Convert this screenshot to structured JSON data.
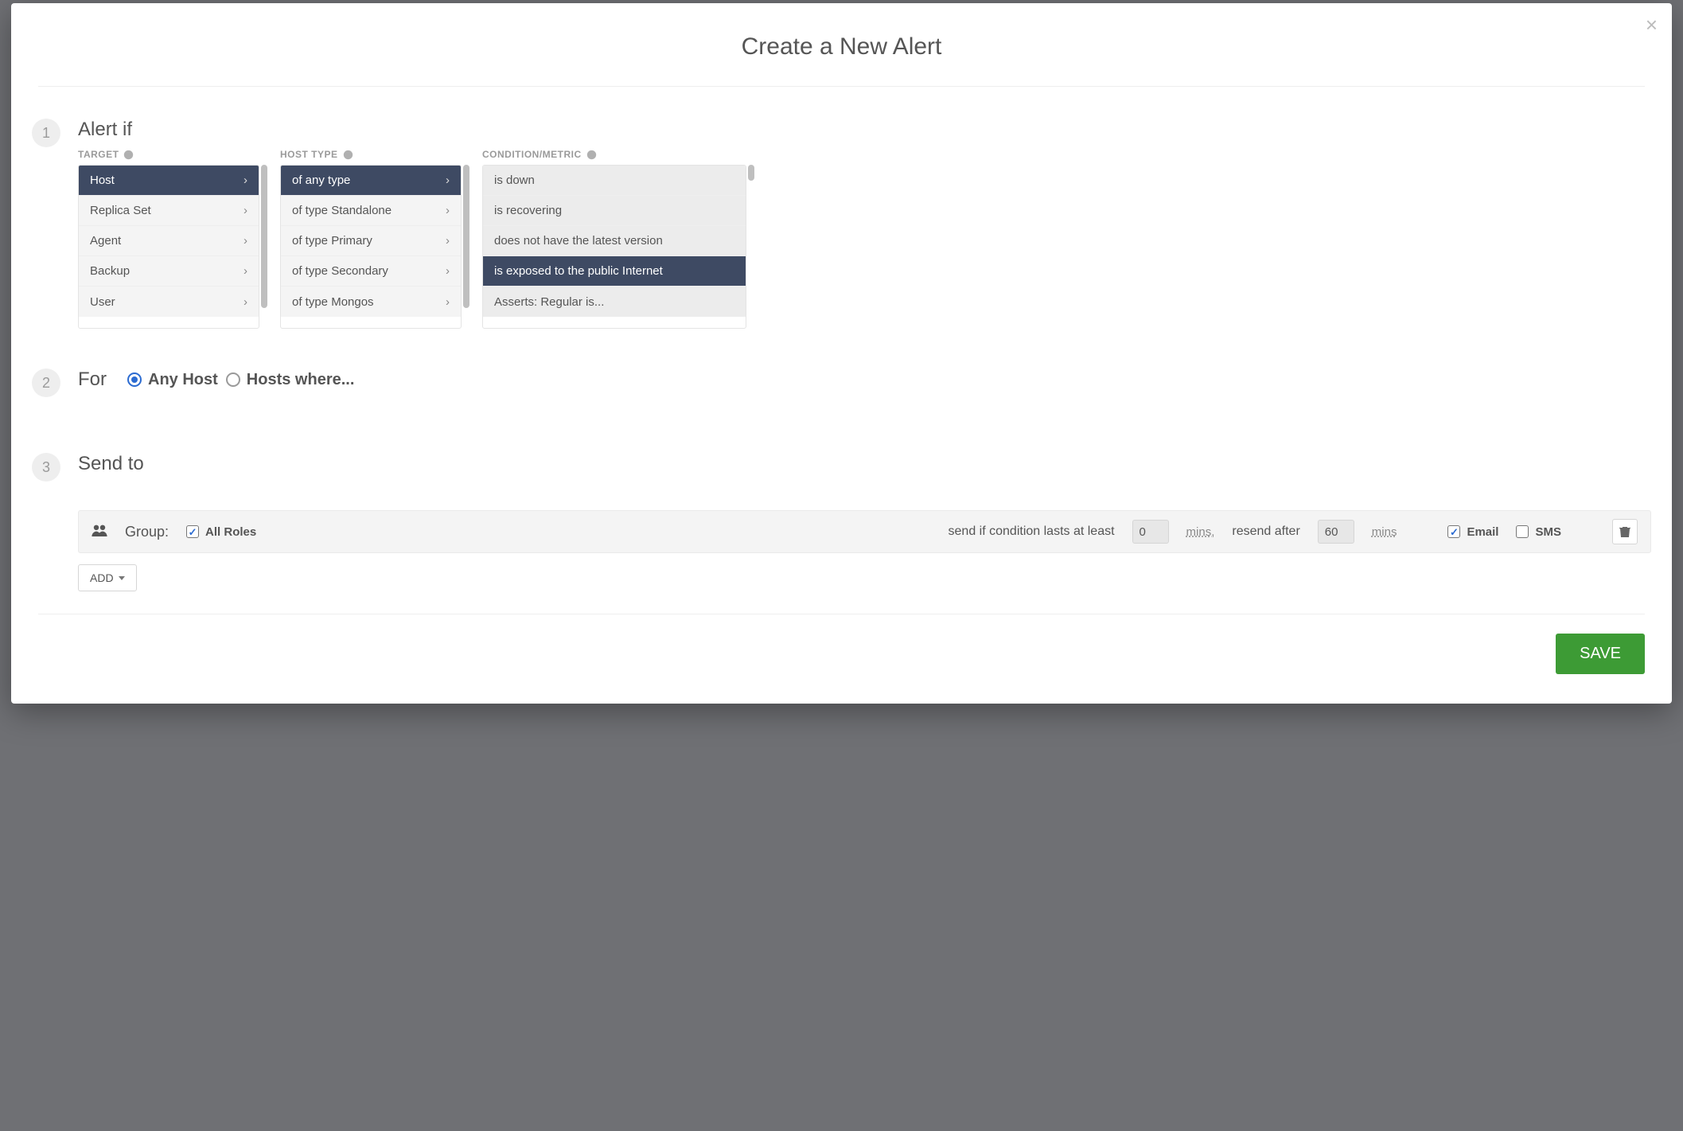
{
  "modal": {
    "title": "Create a New Alert",
    "close_label": "×"
  },
  "step1": {
    "badge": "1",
    "title": "Alert if",
    "headers": {
      "target": "TARGET",
      "hosttype": "HOST TYPE",
      "condition": "CONDITION/METRIC"
    },
    "targets": [
      {
        "label": "Host",
        "selected": true
      },
      {
        "label": "Replica Set",
        "selected": false
      },
      {
        "label": "Agent",
        "selected": false
      },
      {
        "label": "Backup",
        "selected": false
      },
      {
        "label": "User",
        "selected": false
      }
    ],
    "hosttypes": [
      {
        "label": "of any type",
        "selected": true
      },
      {
        "label": "of type Standalone",
        "selected": false
      },
      {
        "label": "of type Primary",
        "selected": false
      },
      {
        "label": "of type Secondary",
        "selected": false
      },
      {
        "label": "of type Mongos",
        "selected": false
      }
    ],
    "conditions": [
      {
        "label": "is down",
        "selected": false
      },
      {
        "label": "is recovering",
        "selected": false
      },
      {
        "label": "does not have the latest version",
        "selected": false
      },
      {
        "label": "is exposed to the public Internet",
        "selected": true
      },
      {
        "label": "Asserts: Regular is...",
        "selected": false
      }
    ]
  },
  "step2": {
    "badge": "2",
    "title": "For",
    "options": [
      {
        "label": "Any Host",
        "selected": true
      },
      {
        "label": "Hosts where...",
        "selected": false
      }
    ]
  },
  "step3": {
    "badge": "3",
    "title": "Send to",
    "group_label": "Group:",
    "all_roles_label": "All Roles",
    "all_roles_checked": true,
    "lasts_text": "send if condition lasts at least",
    "lasts_value": "0",
    "mins_label": "mins,",
    "resend_text": "resend after",
    "resend_value": "60",
    "mins_label2": "mins",
    "email_label": "Email",
    "email_checked": true,
    "sms_label": "SMS",
    "sms_checked": false,
    "add_label": "ADD"
  },
  "footer": {
    "save_label": "SAVE"
  }
}
